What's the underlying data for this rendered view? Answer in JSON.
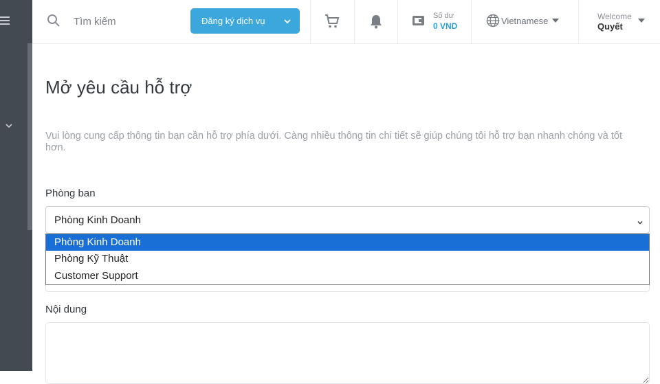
{
  "header": {
    "search": {
      "placeholder": "Tìm kiếm"
    },
    "register_button": "Đăng ký dịch vụ",
    "balance": {
      "label": "Số dư",
      "value": "0 VND"
    },
    "language": "Vietnamese",
    "welcome": {
      "label": "Welcome",
      "name": "Quyết"
    }
  },
  "page": {
    "title": "Mở yêu cầu hỗ trợ",
    "description": "Vui lòng cung cấp thông tin bạn cần hỗ trợ phía dưới. Càng nhiều thông tin chi tiết sẽ giúp chúng tôi hỗ trợ bạn nhanh chóng và tốt hơn.",
    "department": {
      "label": "Phòng ban",
      "selected": "Phòng Kinh Doanh",
      "options": [
        "Phòng Kinh Doanh",
        "Phòng Kỹ Thuật",
        "Customer Support"
      ]
    },
    "content": {
      "label": "Nội dung",
      "value": ""
    }
  },
  "colors": {
    "sidebar": "#444a52",
    "accent": "#3ba7dc",
    "balance": "#2a9fd6",
    "option_highlight": "#1a6fd6"
  }
}
